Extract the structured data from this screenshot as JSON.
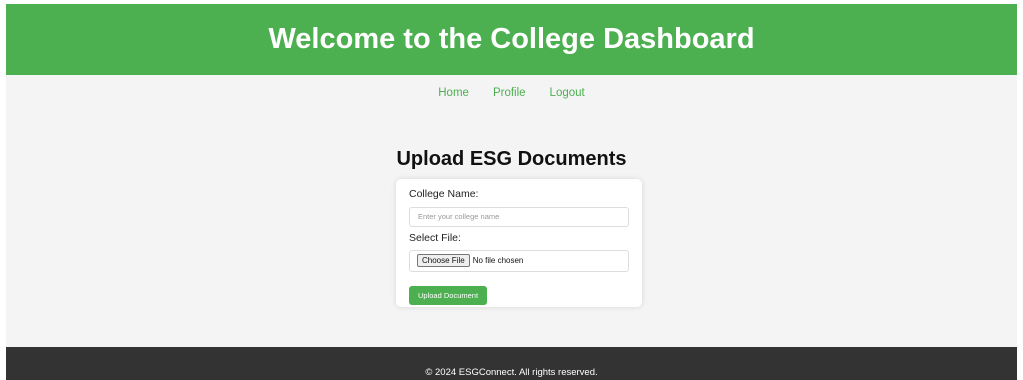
{
  "header": {
    "title": "Welcome to the College Dashboard"
  },
  "nav": {
    "items": [
      {
        "label": "Home"
      },
      {
        "label": "Profile"
      },
      {
        "label": "Logout"
      }
    ]
  },
  "main": {
    "title": "Upload ESG Documents"
  },
  "form": {
    "college_name_label": "College Name:",
    "college_name_value": "",
    "college_name_placeholder": "Enter your college name",
    "file_label": "Select File:",
    "choose_file_label": "Choose File",
    "file_status": "No file chosen",
    "submit_label": "Upload Document"
  },
  "footer": {
    "text": "© 2024 ESGConnect. All rights reserved."
  },
  "colors": {
    "accent": "#4caf50",
    "background": "#f4f4f4",
    "footer_bg": "#333333"
  }
}
